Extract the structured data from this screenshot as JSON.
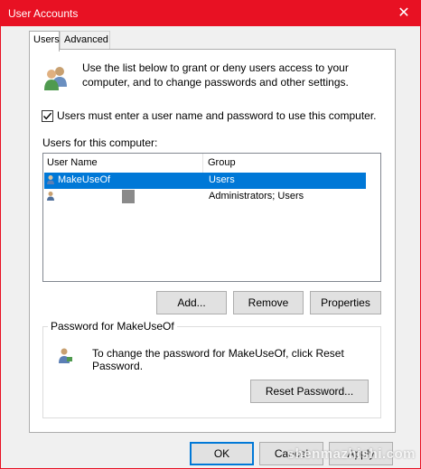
{
  "window": {
    "title": "User Accounts",
    "close_glyph": "✕"
  },
  "tabs": [
    {
      "label": "Users",
      "active": true
    },
    {
      "label": "Advanced",
      "active": false
    }
  ],
  "intro_text": "Use the list below to grant or deny users access to your computer, and to change passwords and other settings.",
  "require_login": {
    "label": "Users must enter a user name and password to use this computer.",
    "checked": true
  },
  "users_label": "Users for this computer:",
  "list": {
    "columns": [
      "User Name",
      "Group"
    ],
    "rows": [
      {
        "name": "MakeUseOf",
        "group": "Users",
        "selected": true
      },
      {
        "name": "",
        "group": "Administrators; Users",
        "selected": false
      }
    ]
  },
  "buttons": {
    "add": "Add...",
    "remove": "Remove",
    "properties": "Properties"
  },
  "password_group": {
    "legend": "Password for MakeUseOf",
    "text": "To change the password for MakeUseOf, click Reset Password.",
    "reset_button": "Reset Password..."
  },
  "footer": {
    "ok": "OK",
    "cancel": "Cancel",
    "apply": "Apply"
  },
  "watermark": "shenmazhishi.com",
  "colors": {
    "titlebar": "#e81123",
    "selection": "#0078d7",
    "button_face": "#e1e1e1"
  }
}
